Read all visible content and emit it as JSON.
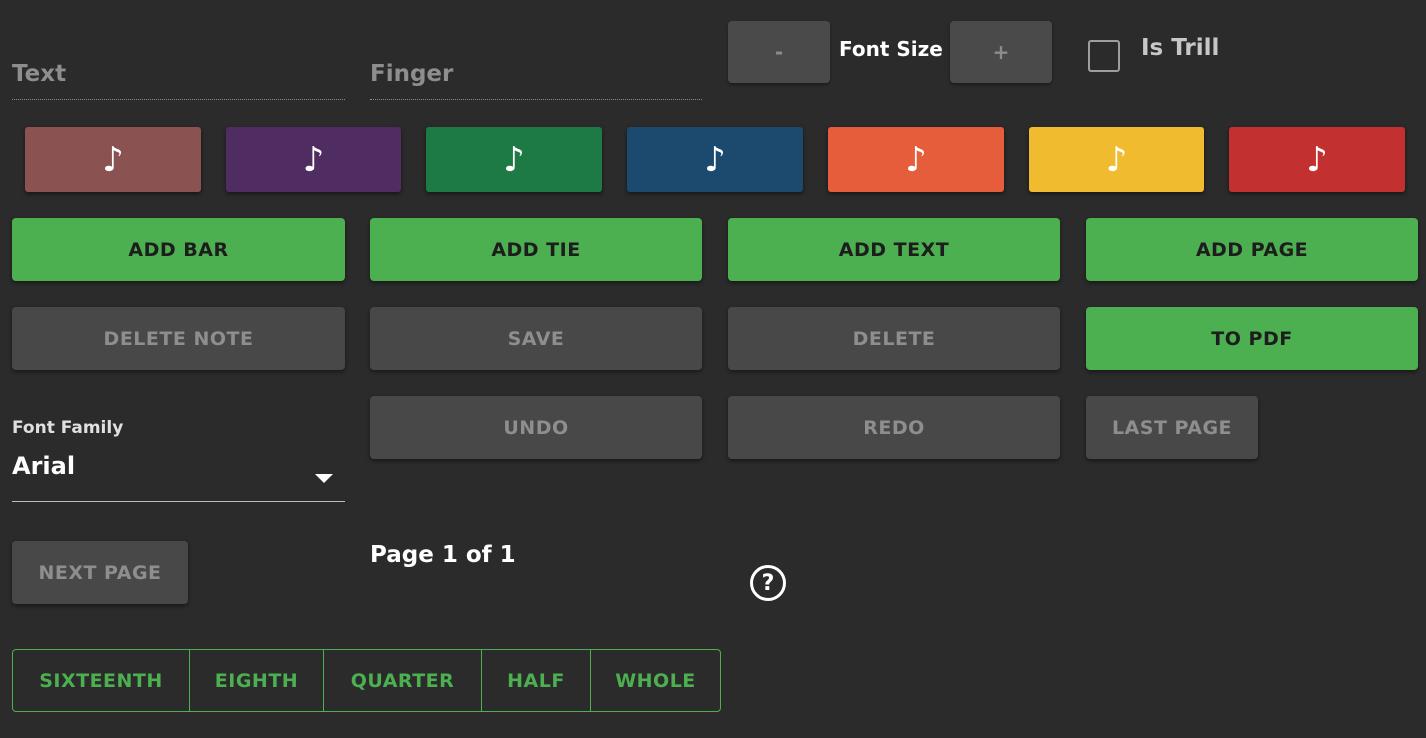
{
  "inputs": {
    "text": {
      "placeholder": "Text",
      "value": ""
    },
    "finger": {
      "placeholder": "Finger",
      "value": ""
    }
  },
  "font_size": {
    "decrease_label": "-",
    "label": "Font Size",
    "increase_label": "+"
  },
  "trill": {
    "label": "Is Trill",
    "checked": false
  },
  "note_colors": [
    {
      "icon": "♪",
      "color": "#8b5252"
    },
    {
      "icon": "♪",
      "color": "#4f2d63"
    },
    {
      "icon": "♪",
      "color": "#1d7a45"
    },
    {
      "icon": "♪",
      "color": "#1c4a6e"
    },
    {
      "icon": "♪",
      "color": "#e55d3b"
    },
    {
      "icon": "♪",
      "color": "#f0bb2f"
    },
    {
      "icon": "♪",
      "color": "#c33030"
    }
  ],
  "actions": {
    "add_bar": "ADD BAR",
    "add_tie": "ADD TIE",
    "add_text": "ADD TEXT",
    "add_page": "ADD PAGE",
    "delete_note": "DELETE NOTE",
    "save": "SAVE",
    "delete": "DELETE",
    "to_pdf": "TO PDF",
    "undo": "UNDO",
    "redo": "REDO",
    "last_page": "LAST PAGE",
    "next_page": "NEXT PAGE"
  },
  "font_family": {
    "label": "Font Family",
    "selected": "Arial"
  },
  "pagination": {
    "text": "Page 1 of 1"
  },
  "help": {
    "icon": "?"
  },
  "durations": [
    "SIXTEENTH",
    "EIGHTH",
    "QUARTER",
    "HALF",
    "WHOLE"
  ],
  "colors": {
    "accent_green": "#4caf50",
    "background": "#2b2b2b",
    "disabled": "#484848"
  }
}
